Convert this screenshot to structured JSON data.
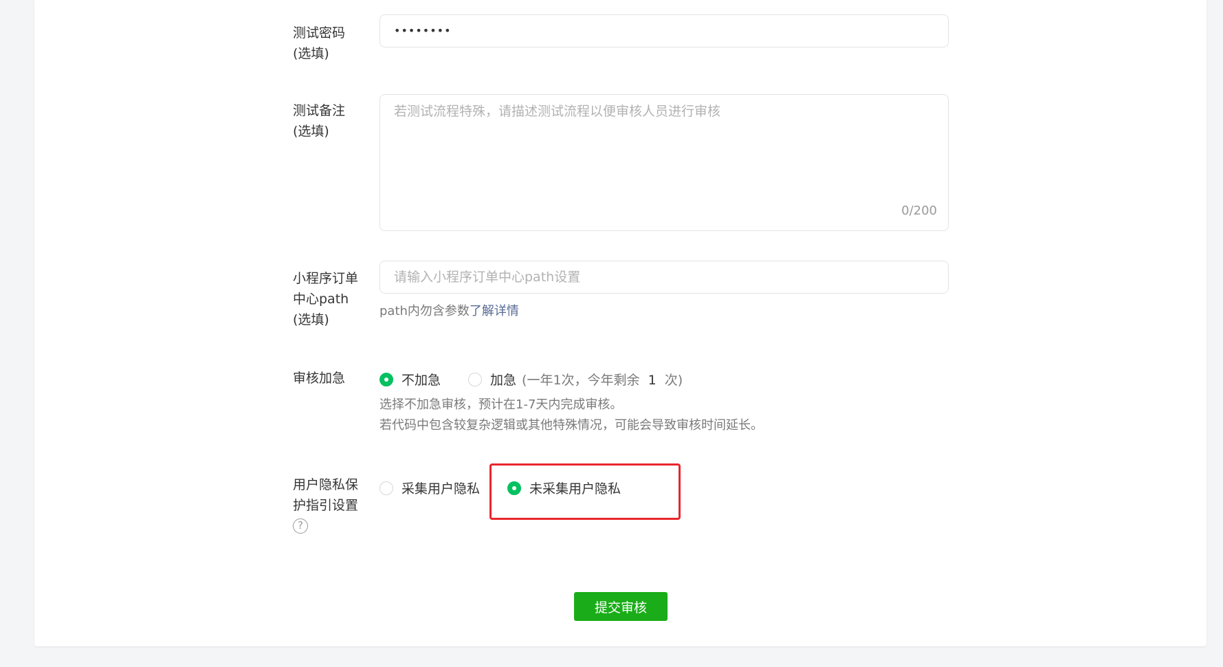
{
  "fields": {
    "password": {
      "label_line1": "测试密码",
      "label_line2": "(选填)",
      "value": "••••••••"
    },
    "notes": {
      "label_line1": "测试备注",
      "label_line2": "(选填)",
      "placeholder": "若测试流程特殊，请描述测试流程以便审核人员进行审核",
      "counter": "0/200"
    },
    "order_path": {
      "label_line1": "小程序订单",
      "label_line2": "中心path",
      "label_line3": "(选填)",
      "placeholder": "请输入小程序订单中心path设置",
      "hint_text": "path内勿含参数",
      "hint_link": "了解详情"
    },
    "expedite": {
      "label": "审核加急",
      "option_normal": "不加急",
      "option_expedite": "加急",
      "expedite_note_prefix": "(一年1次，今年剩余",
      "expedite_remaining": "1",
      "expedite_note_suffix": "次)",
      "hint_line1": "选择不加急审核，预计在1-7天内完成审核。",
      "hint_line2": "若代码中包含较复杂逻辑或其他特殊情况，可能会导致审核时间延长。",
      "selected": "option_normal"
    },
    "privacy": {
      "label_line1": "用户隐私保",
      "label_line2": "护指引设置",
      "help_glyph": "?",
      "option_collect": "采集用户隐私",
      "option_no_collect": "未采集用户隐私",
      "selected": "option_no_collect"
    }
  },
  "submit_label": "提交审核",
  "colors": {
    "accent_green": "#07c160",
    "button_green": "#1aad19",
    "link_blue": "#576b95",
    "highlight_red": "#e8262b"
  }
}
